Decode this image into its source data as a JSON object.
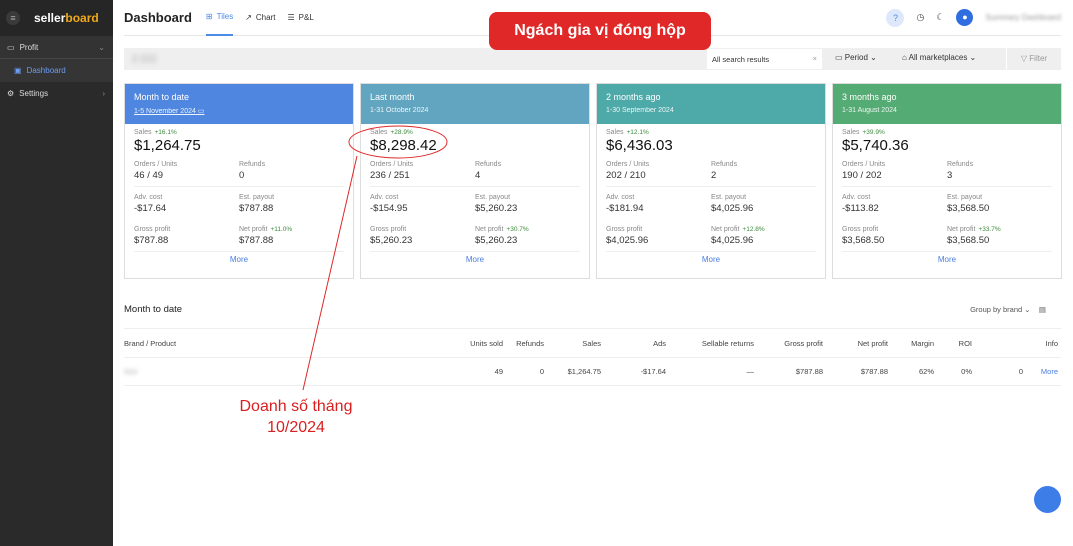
{
  "sidebar": {
    "brand_a": "seller",
    "brand_b": "board",
    "items": [
      {
        "label": "Profit"
      },
      {
        "label": "Dashboard"
      },
      {
        "label": "Settings"
      }
    ]
  },
  "header": {
    "title": "Dashboard",
    "tabs": [
      {
        "label": "Tiles"
      },
      {
        "label": "Chart"
      },
      {
        "label": "P&L"
      }
    ],
    "user": "Summary Dashboard",
    "help": "?"
  },
  "filters": {
    "search_value": "All search results",
    "period": "Period",
    "marketplaces": "All marketplaces",
    "filter": "Filter"
  },
  "tiles": [
    {
      "title": "Month to date",
      "date": "1-5 November 2024",
      "color": "#4f87e0",
      "sales_pct": "+16.1%",
      "sales": "$1,264.75",
      "orders_units": "46 / 49",
      "refunds": "0",
      "adv_cost": "-$17.64",
      "est_payout": "$787.88",
      "gross_profit": "$787.88",
      "net_profit_pct": "+11.0%",
      "net_profit": "$787.88"
    },
    {
      "title": "Last month",
      "date": "1-31 October 2024",
      "color": "#61a5c0",
      "sales_pct": "+28.9%",
      "sales": "$8,298.42",
      "orders_units": "236 / 251",
      "refunds": "4",
      "adv_cost": "-$154.95",
      "est_payout": "$5,260.23",
      "gross_profit": "$5,260.23",
      "net_profit_pct": "+30.7%",
      "net_profit": "$5,260.23"
    },
    {
      "title": "2 months ago",
      "date": "1-30 September 2024",
      "color": "#4ea9a9",
      "sales_pct": "+12.1%",
      "sales": "$6,436.03",
      "orders_units": "202 / 210",
      "refunds": "2",
      "adv_cost": "-$181.94",
      "est_payout": "$4,025.96",
      "gross_profit": "$4,025.96",
      "net_profit_pct": "+12.8%",
      "net_profit": "$4,025.96"
    },
    {
      "title": "3 months ago",
      "date": "1-31 August 2024",
      "color": "#55ab74",
      "sales_pct": "+39.9%",
      "sales": "$5,740.36",
      "orders_units": "190 / 202",
      "refunds": "3",
      "adv_cost": "-$113.82",
      "est_payout": "$3,568.50",
      "gross_profit": "$3,568.50",
      "net_profit_pct": "+33.7%",
      "net_profit": "$3,568.50"
    }
  ],
  "tile_labels": {
    "sales": "Sales",
    "orders_units": "Orders / Units",
    "refunds": "Refunds",
    "adv_cost": "Adv. cost",
    "est_payout": "Est. payout",
    "gross_profit": "Gross profit",
    "net_profit": "Net profit",
    "more": "More"
  },
  "table": {
    "title": "Month to date",
    "group_by": "Group by brand",
    "columns": [
      "Brand / Product",
      "Units sold",
      "Refunds",
      "Sales",
      "Ads",
      "Sellable returns",
      "Gross profit",
      "Net profit",
      "Margin",
      "ROI",
      "Info"
    ],
    "rows": [
      {
        "brand": "Noir",
        "units": "49",
        "refunds": "0",
        "sales": "$1,264.75",
        "ads": "-$17.64",
        "sellable_returns": "—",
        "gross_profit": "$787.88",
        "net_profit": "$787.88",
        "margin": "62%",
        "roi": "0%",
        "info_count": "0",
        "info": "More"
      }
    ]
  },
  "annotations": {
    "badge": "Ngách gia vị đóng hộp",
    "note_line1": "Doanh số tháng",
    "note_line2": "10/2024",
    "color": "#e02828"
  }
}
